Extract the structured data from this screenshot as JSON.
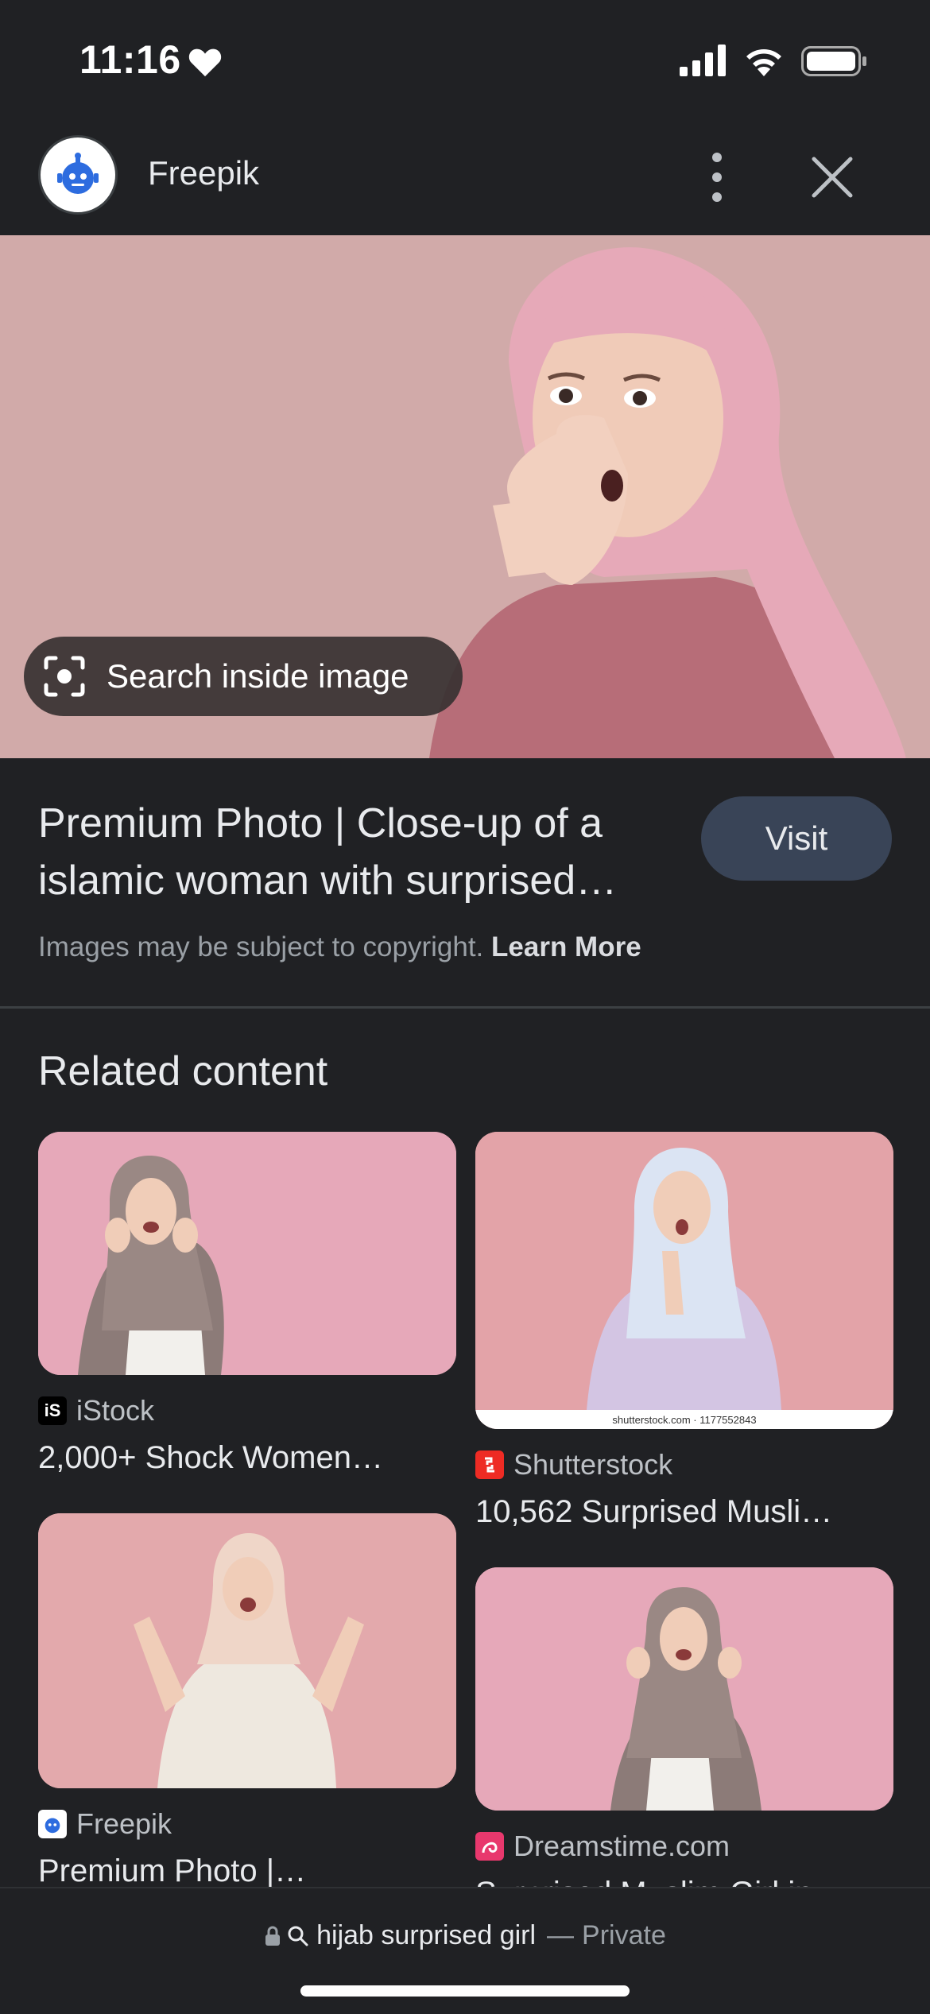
{
  "status_bar": {
    "time": "11:16"
  },
  "header": {
    "site_name": "Freepik"
  },
  "hero": {
    "search_inside_label": "Search inside image"
  },
  "result": {
    "title": "Premium Photo | Close-up of a islamic woman with surprised…",
    "visit_label": "Visit",
    "copyright_text": "Images may be subject to copyright.",
    "learn_more": "Learn More"
  },
  "related": {
    "heading": "Related content",
    "items": [
      {
        "source": "iStock",
        "desc": "2,000+ Shock Women…"
      },
      {
        "source": "Shutterstock",
        "desc": "10,562 Surprised Musli…",
        "watermark": "shutterstock.com · 1177552843"
      },
      {
        "source": "Freepik",
        "desc": "Premium Photo |…"
      },
      {
        "source": "Dreamstime.com",
        "desc": "Surprised Muslim Girl in…"
      }
    ]
  },
  "bottom_bar": {
    "query": "hijab surprised girl",
    "separator": "—",
    "private_label": "Private"
  },
  "colors": {
    "background": "#202124",
    "visit_button": "#394457",
    "hero_bg": "#d1aaa9"
  }
}
